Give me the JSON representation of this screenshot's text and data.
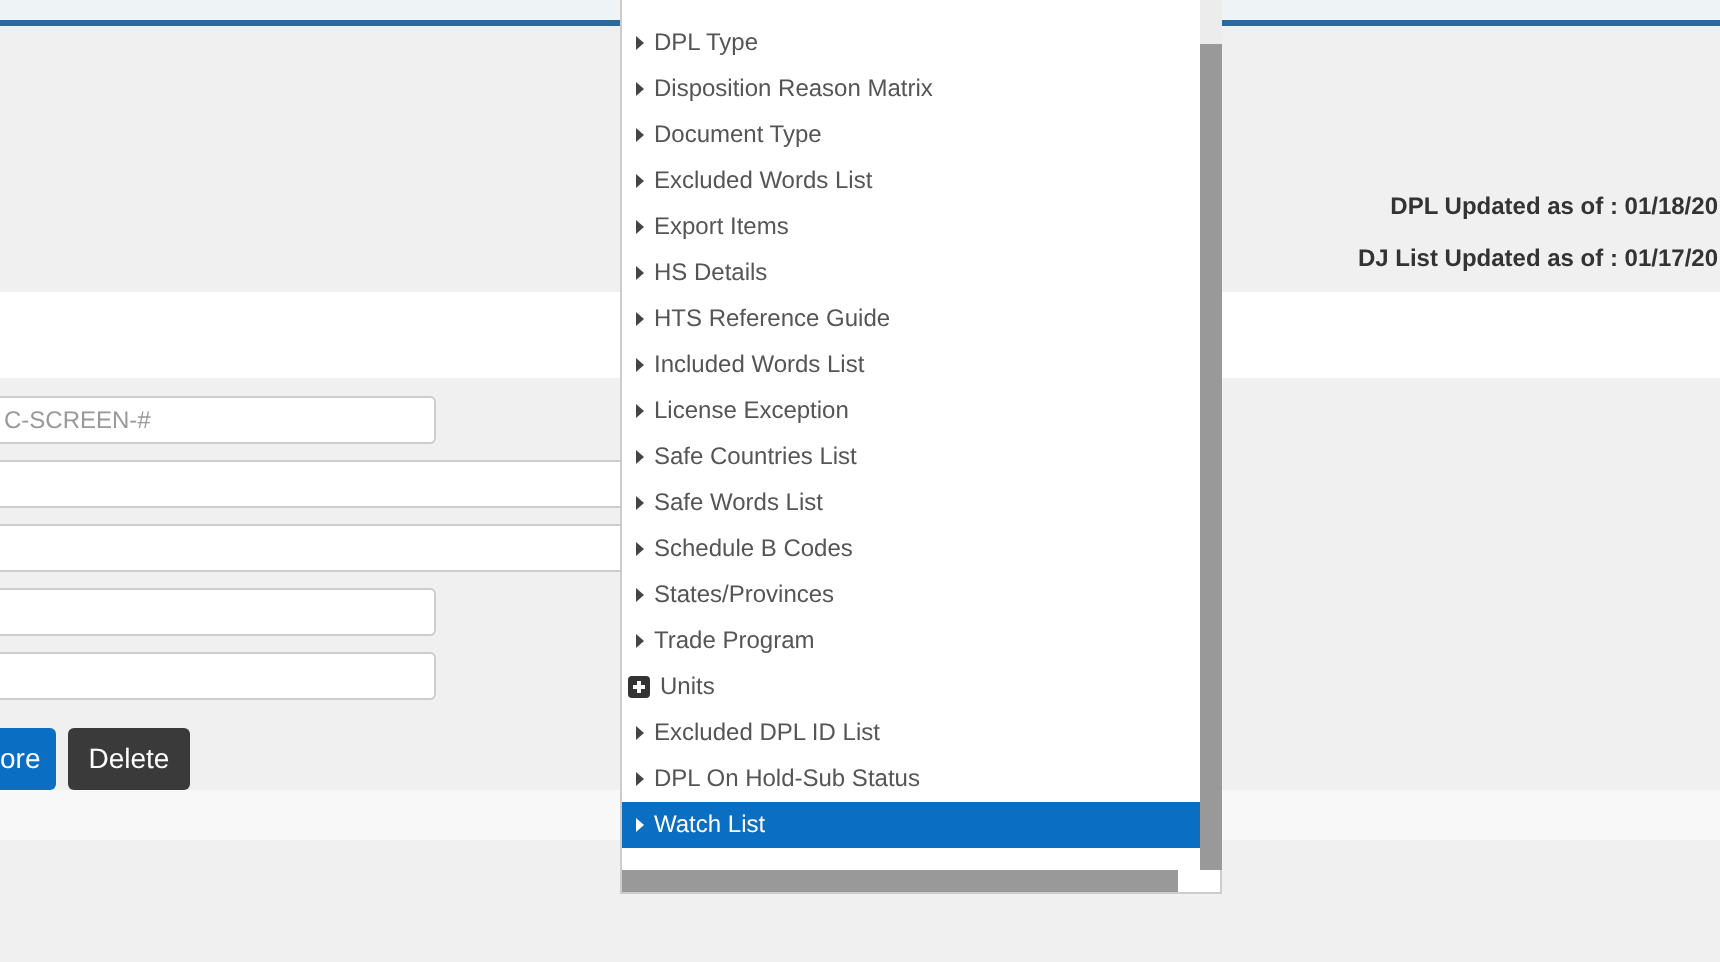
{
  "header": {
    "updates": [
      "DPL Updated as of : 01/18/20",
      "DJ List Updated as of : 01/17/20"
    ]
  },
  "form": {
    "fields": [
      {
        "placeholder": "C-SCREEN-#",
        "kind": "short"
      },
      {
        "kind": "wide"
      },
      {
        "kind": "wide"
      },
      {
        "kind": "short"
      },
      {
        "kind": "short"
      }
    ],
    "buttons": [
      {
        "label": "ore",
        "kind": "primary"
      },
      {
        "label": "Delete",
        "kind": "dark"
      }
    ]
  },
  "dropdown": {
    "items": [
      {
        "label": "DPL Type",
        "kind": "leaf",
        "selected": false
      },
      {
        "label": "Disposition Reason Matrix",
        "kind": "leaf",
        "selected": false
      },
      {
        "label": "Document Type",
        "kind": "leaf",
        "selected": false
      },
      {
        "label": "Excluded Words List",
        "kind": "leaf",
        "selected": false
      },
      {
        "label": "Export Items",
        "kind": "leaf",
        "selected": false
      },
      {
        "label": "HS Details",
        "kind": "leaf",
        "selected": false
      },
      {
        "label": "HTS Reference Guide",
        "kind": "leaf",
        "selected": false
      },
      {
        "label": "Included Words List",
        "kind": "leaf",
        "selected": false
      },
      {
        "label": "License Exception",
        "kind": "leaf",
        "selected": false
      },
      {
        "label": "Safe Countries List",
        "kind": "leaf",
        "selected": false
      },
      {
        "label": "Safe Words List",
        "kind": "leaf",
        "selected": false
      },
      {
        "label": "Schedule B Codes",
        "kind": "leaf",
        "selected": false
      },
      {
        "label": "States/Provinces",
        "kind": "leaf",
        "selected": false
      },
      {
        "label": "Trade Program",
        "kind": "leaf",
        "selected": false
      },
      {
        "label": "Units",
        "kind": "group",
        "selected": false
      },
      {
        "label": "Excluded DPL ID List",
        "kind": "leaf",
        "selected": false
      },
      {
        "label": "DPL On Hold-Sub Status",
        "kind": "leaf",
        "selected": false
      },
      {
        "label": "Watch List",
        "kind": "leaf",
        "selected": true
      }
    ]
  }
}
